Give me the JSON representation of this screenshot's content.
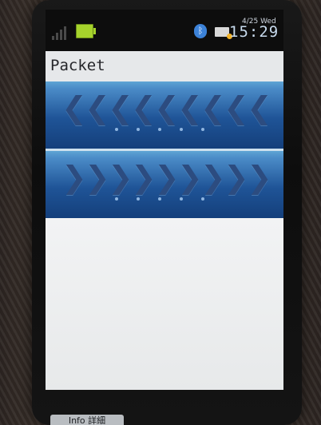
{
  "status": {
    "date": "4/25 Wed",
    "time": "15:29"
  },
  "screen": {
    "title": "Packet"
  },
  "bands": {
    "upload": {
      "arrow_glyph": "❮",
      "arrow_count": 9,
      "dot_count": 5
    },
    "download": {
      "arrow_glyph": "❯",
      "arrow_count": 9,
      "dot_count": 5
    }
  },
  "softkeys": {
    "left_label": "Info 詳細"
  },
  "colors": {
    "band_light": "#5ea4d4",
    "band_dark": "#143f7b",
    "arrow": "#2c4c80",
    "battery": "#a6d32c",
    "bluetooth": "#3c82d8",
    "screen_bg": "#e8eaec"
  },
  "icons": [
    "signal-icon",
    "battery-icon",
    "bluetooth-icon",
    "mail-icon"
  ]
}
